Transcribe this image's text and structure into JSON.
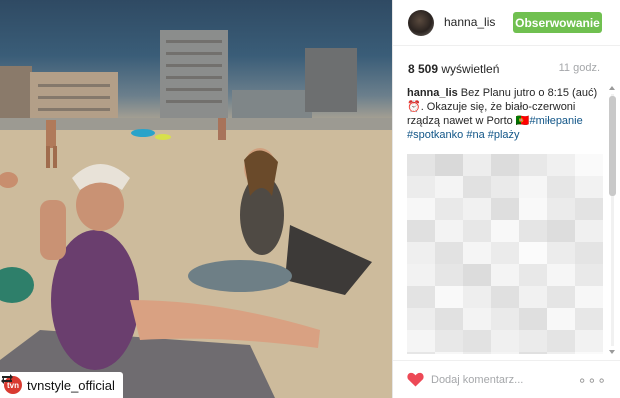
{
  "post": {
    "username": "hanna_lis",
    "follow_label": "Obserwowanie",
    "views_count": "8 509",
    "views_word": "wyświetleń",
    "time_ago": "11 godz.",
    "caption_user": "hanna_lis",
    "caption_text": "Bez Planu jutro o 8:15 (auć)⏰. Okazuje się, że biało-czerwoni rządzą nawet w Porto 🇵🇹",
    "hashtags": [
      "#miłepanie",
      "#spotkanko",
      "#na",
      "#plaży"
    ],
    "comment_placeholder": "Dodaj komentarz...",
    "more_label": "∘∘∘"
  },
  "repost": {
    "account": "tvnstyle_official",
    "avatar_text": "tvn"
  },
  "colors": {
    "follow_bg": "#70c050",
    "hashtag": "#125688",
    "heart": "#ed4956"
  },
  "icons": {
    "repost": "repost-icon",
    "heart": "heart-icon",
    "more": "more-options-icon"
  }
}
